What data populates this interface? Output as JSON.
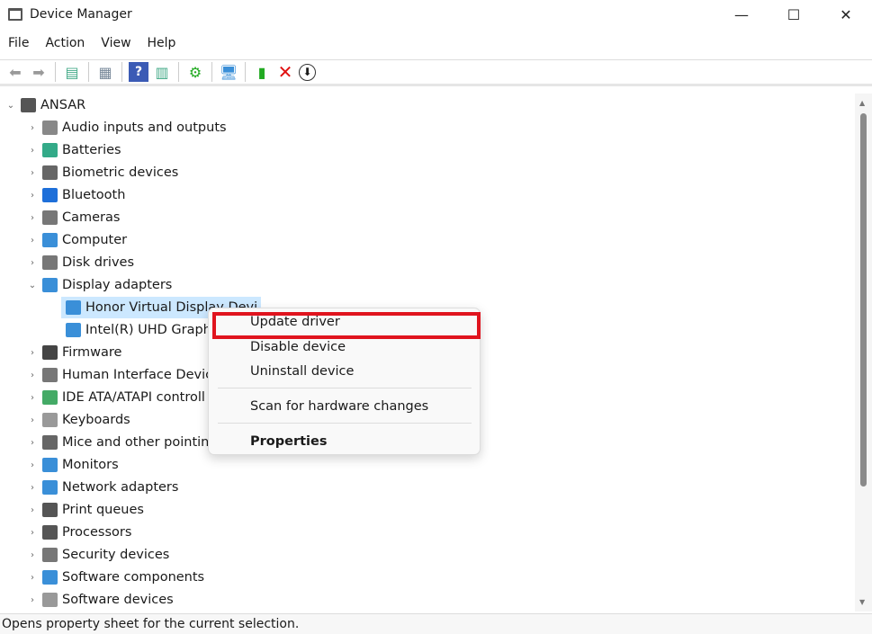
{
  "window": {
    "title": "Device Manager",
    "minimize": "—",
    "maximize": "☐",
    "close": "✕"
  },
  "menu": [
    "File",
    "Action",
    "View",
    "Help"
  ],
  "toolbar": [
    "back-icon",
    "forward-icon",
    "show-hide-console-tree-icon",
    "properties-icon",
    "help-icon",
    "action-pane-icon",
    "update-driver-icon",
    "scan-hardware-icon",
    "enable-device-icon",
    "uninstall-icon",
    "disable-download-icon"
  ],
  "tree": {
    "root": "ANSAR",
    "items": [
      "Audio inputs and outputs",
      "Batteries",
      "Biometric devices",
      "Bluetooth",
      "Cameras",
      "Computer",
      "Disk drives",
      "Display adapters"
    ],
    "display_children": [
      "Honor Virtual Display Devi",
      "Intel(R) UHD Graph"
    ],
    "items2": [
      "Firmware",
      "Human Interface Devic",
      "IDE ATA/ATAPI controll",
      "Keyboards",
      "Mice and other pointin",
      "Monitors",
      "Network adapters",
      "Print queues",
      "Processors",
      "Security devices",
      "Software components",
      "Software devices"
    ]
  },
  "context_menu": {
    "update": "Update driver",
    "disable": "Disable device",
    "uninstall": "Uninstall device",
    "scan": "Scan for hardware changes",
    "properties": "Properties"
  },
  "status": "Opens property sheet for the current selection.",
  "colors": {
    "highlight_border": "#e0141e",
    "selection": "#cce8ff"
  }
}
